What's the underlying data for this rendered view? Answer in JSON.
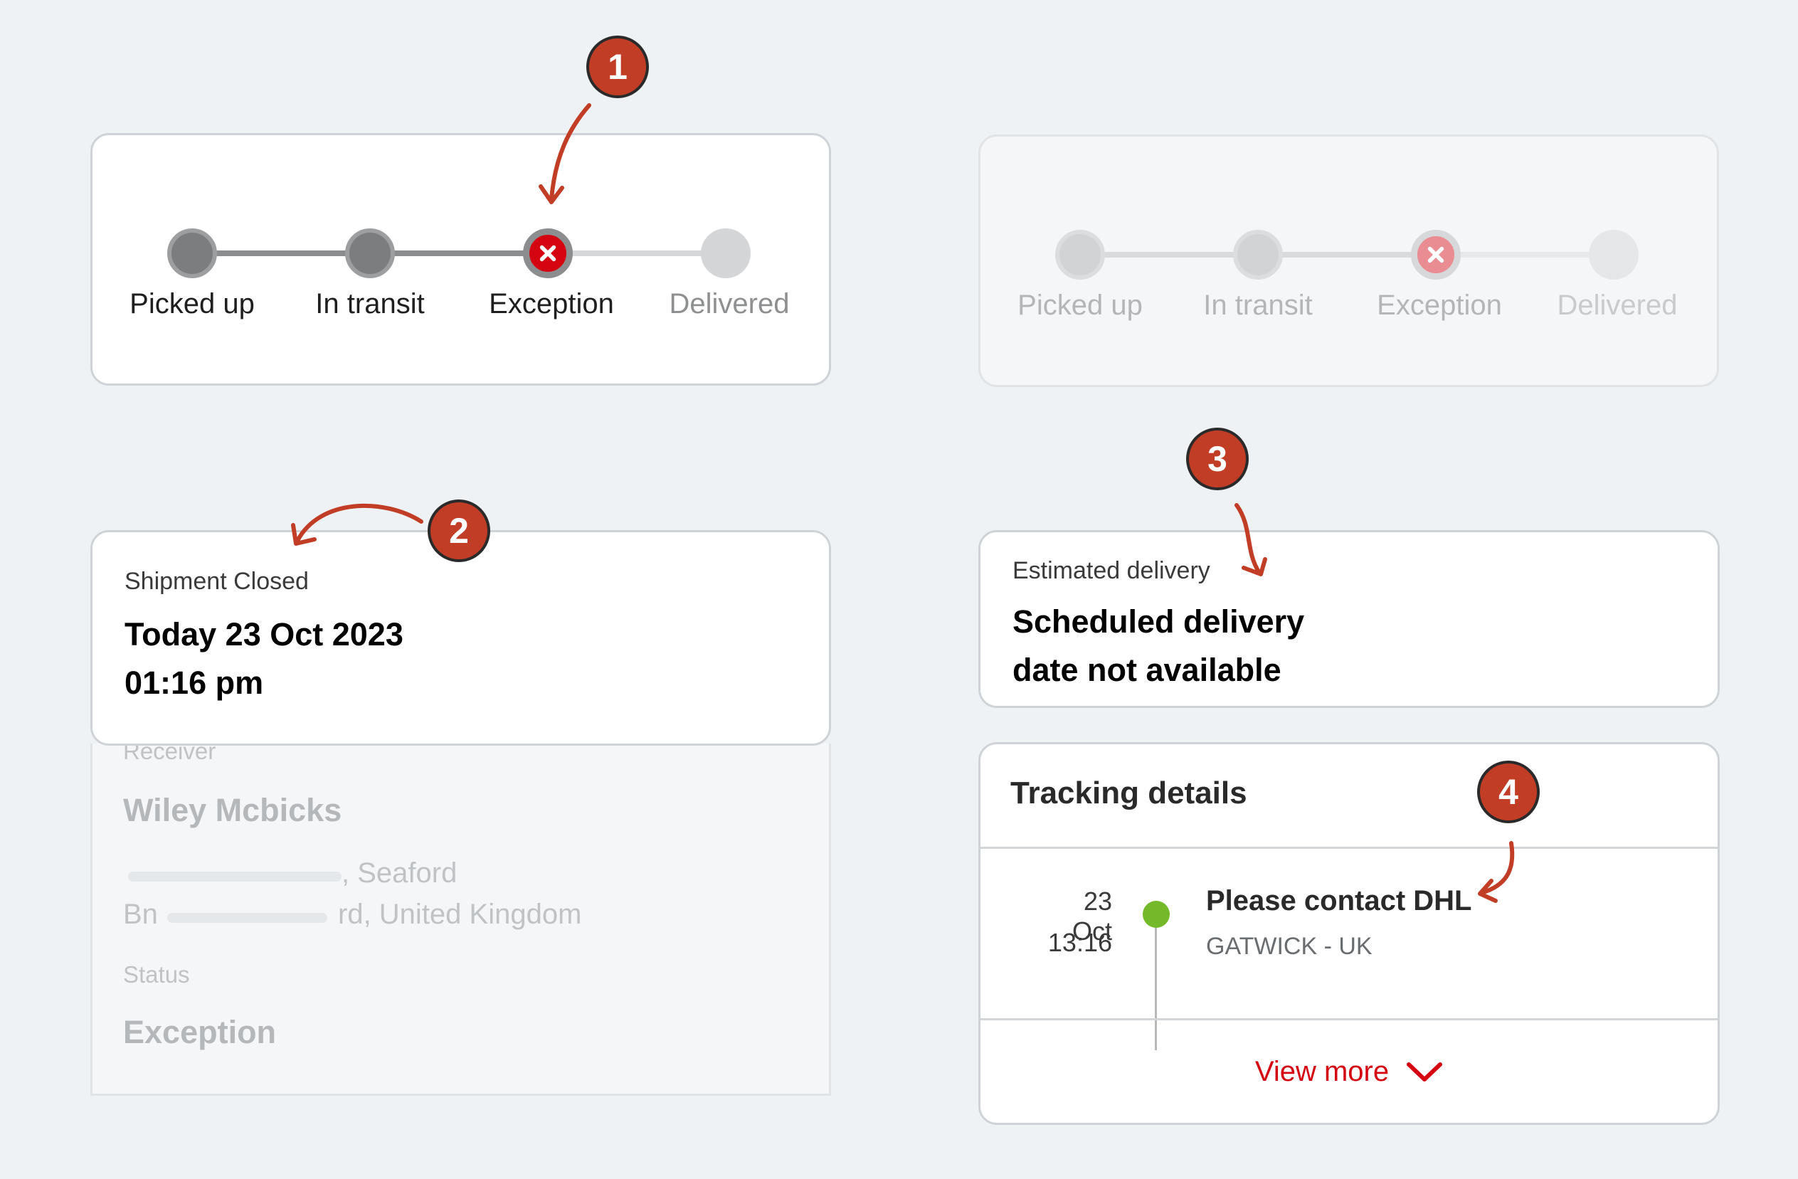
{
  "tracker": {
    "steps": [
      {
        "label": "Picked up",
        "state": "done"
      },
      {
        "label": "In transit",
        "state": "done"
      },
      {
        "label": "Exception",
        "state": "error"
      },
      {
        "label": "Delivered",
        "state": "pending"
      }
    ]
  },
  "annotations": [
    "1",
    "2",
    "3",
    "4"
  ],
  "shipment_closed": {
    "label": "Shipment Closed",
    "date": "Today 23 Oct 2023",
    "time": "01:16 pm"
  },
  "receiver": {
    "label": "Receiver",
    "name": "Wiley Mcbicks",
    "address_line1_tail": ", Seaford",
    "address_line2_head": "Bn",
    "address_line2_tail": "rd, United Kingdom",
    "status_label": "Status",
    "status_value": "Exception"
  },
  "estimated_delivery": {
    "label": "Estimated delivery",
    "line1": "Scheduled delivery",
    "line2": "date not available"
  },
  "tracking": {
    "title": "Tracking details",
    "event": {
      "date": "23 Oct",
      "time": "13:16",
      "title": "Please contact DHL",
      "location": "GATWICK - UK"
    },
    "view_more": "View more"
  },
  "colors": {
    "accent_red": "#d40511",
    "annotation": "#c23d25",
    "success_green": "#74b929"
  },
  "icons": [
    "close-icon",
    "chevron-down-icon"
  ]
}
